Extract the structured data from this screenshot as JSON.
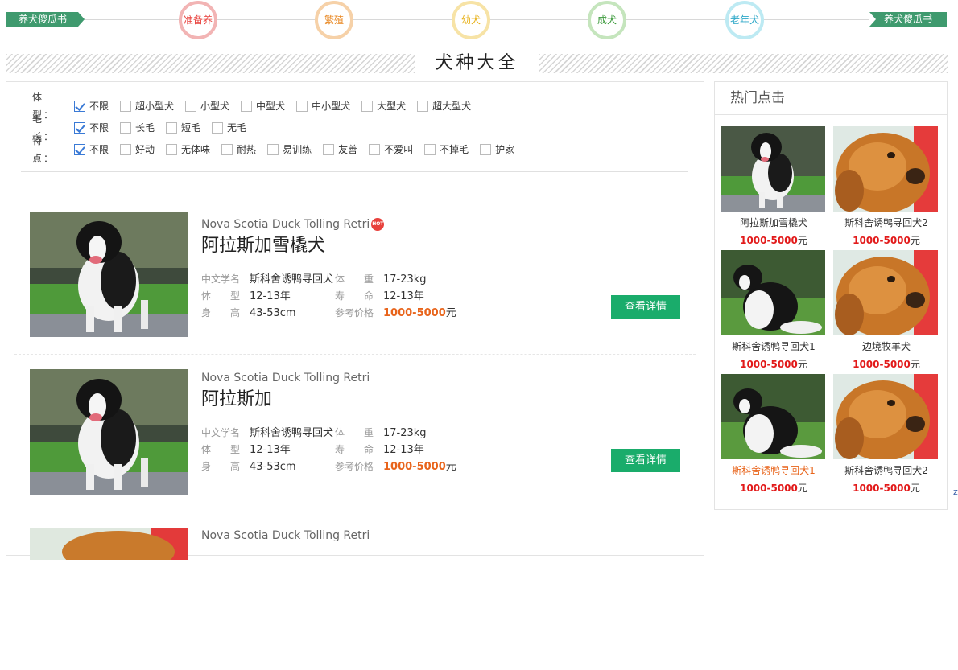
{
  "nav": {
    "left_flag": "养犬傻瓜书",
    "right_flag": "养犬傻瓜书",
    "stages": [
      {
        "label": "准备养",
        "color": "#e8413c",
        "ring": "#f2b4b4"
      },
      {
        "label": "繁殖",
        "color": "#e8841b",
        "ring": "#f6d1a8"
      },
      {
        "label": "幼犬",
        "color": "#e8b21b",
        "ring": "#f7e3a6"
      },
      {
        "label": "成犬",
        "color": "#3d9b3d",
        "ring": "#c5e5bd"
      },
      {
        "label": "老年犬",
        "color": "#2fa8c8",
        "ring": "#bdeaf3"
      }
    ]
  },
  "section_title": "犬种大全",
  "filters": [
    {
      "label": "体　型：",
      "options": [
        "不限",
        "超小型犬",
        "小型犬",
        "中型犬",
        "中小型犬",
        "大型犬",
        "超大型犬"
      ],
      "checked": [
        0
      ]
    },
    {
      "label": "毛　长：",
      "options": [
        "不限",
        "长毛",
        "短毛",
        "无毛"
      ],
      "checked": [
        0
      ]
    },
    {
      "label": "特　点：",
      "options": [
        "不限",
        "好动",
        "无体味",
        "耐热",
        "易训练",
        "友善",
        "不爱叫",
        "不掉毛",
        "护家"
      ],
      "checked": [
        0
      ]
    }
  ],
  "listings": [
    {
      "en_name": "Nova Scotia Duck Tolling Retri",
      "hot": "HOT",
      "cn_name": "阿拉斯加雪橇犬",
      "sci_label": "中文学名",
      "sci_value": "斯科舍诱鸭寻回犬",
      "weight_label": "体　　重",
      "weight_value": "17-23kg",
      "type_label": "体　　型",
      "type_value": "12-13年",
      "life_label": "寿　　命",
      "life_value": "12-13年",
      "height_label": "身　　高",
      "height_value": "43-53cm",
      "price_label": "参考价格",
      "price_value": "1000-5000",
      "price_unit": "元",
      "button": "查看详情",
      "photo": "dog-border-collie"
    },
    {
      "en_name": "Nova Scotia Duck Tolling Retri",
      "cn_name": "阿拉斯加",
      "sci_label": "中文学名",
      "sci_value": "斯科舍诱鸭寻回犬",
      "weight_label": "体　　重",
      "weight_value": "17-23kg",
      "type_label": "体　　型",
      "type_value": "12-13年",
      "life_label": "寿　　命",
      "life_value": "12-13年",
      "height_label": "身　　高",
      "height_value": "43-53cm",
      "price_label": "参考价格",
      "price_value": "1000-5000",
      "price_unit": "元",
      "button": "查看详情",
      "photo": "dog-border-collie"
    },
    {
      "en_name": "Nova Scotia Duck Tolling Retri",
      "photo": "dog-golden-retriever"
    }
  ],
  "hot_clicks": {
    "title": "热门点击",
    "items": [
      {
        "name": "阿拉斯加雪橇犬",
        "price": "1000-5000",
        "unit": "元",
        "photo": "dog-border-collie"
      },
      {
        "name": "斯科舍诱鸭寻回犬2",
        "price": "1000-5000",
        "unit": "元",
        "photo": "dog-golden-retriever"
      },
      {
        "name": "斯科舍诱鸭寻回犬1",
        "price": "1000-5000",
        "unit": "元",
        "photo": "dog-border-collie-sitting"
      },
      {
        "name": "边境牧羊犬",
        "price": "1000-5000",
        "unit": "元",
        "photo": "dog-golden-retriever"
      },
      {
        "name": "斯科舍诱鸭寻回犬1",
        "price": "1000-5000",
        "unit": "元",
        "photo": "dog-border-collie-sitting",
        "active": true
      },
      {
        "name": "斯科舍诱鸭寻回犬2",
        "price": "1000-5000",
        "unit": "元",
        "photo": "dog-golden-retriever"
      }
    ]
  },
  "colors": {
    "accent_green": "#1aac6b",
    "price_orange": "#e8641b",
    "price_red": "#e21a1a",
    "nav_green": "#3f9a6e"
  }
}
